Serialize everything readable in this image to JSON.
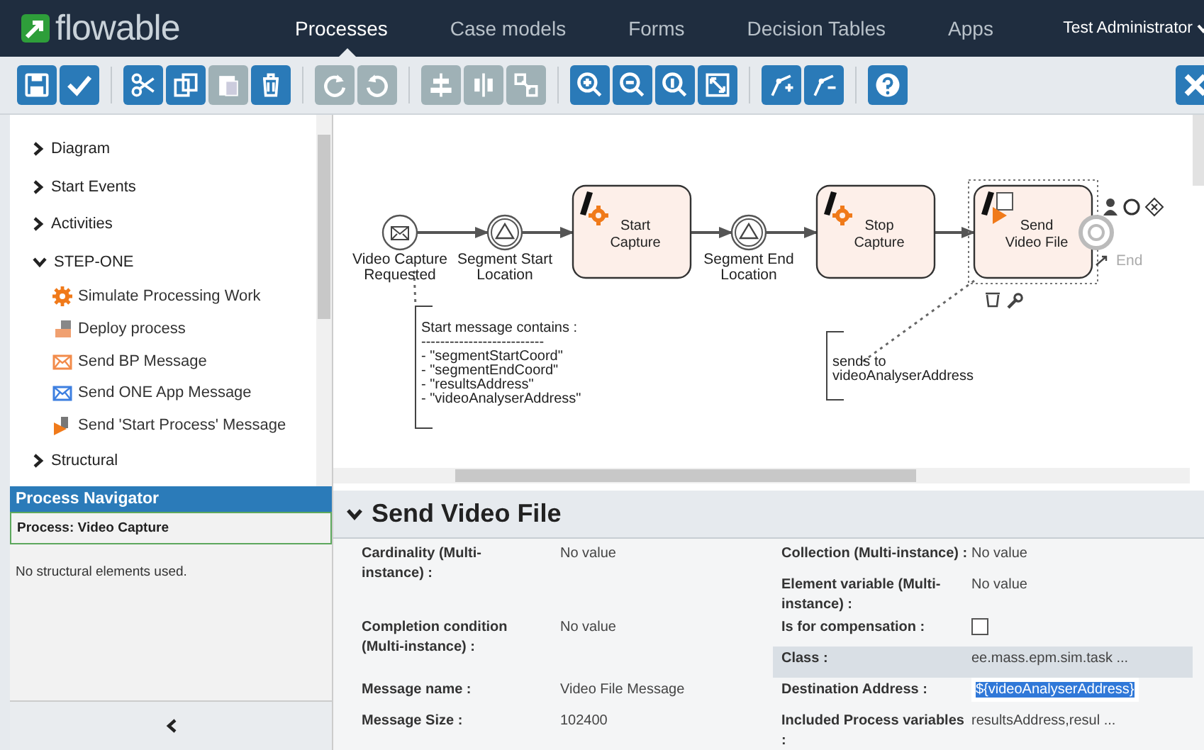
{
  "header": {
    "logo": "flowable",
    "nav": [
      {
        "label": "Processes",
        "selected": true
      },
      {
        "label": "Case models",
        "selected": false
      },
      {
        "label": "Forms",
        "selected": false
      },
      {
        "label": "Decision Tables",
        "selected": false
      },
      {
        "label": "Apps",
        "selected": false
      }
    ],
    "user": "Test Administrator"
  },
  "toolbar": {
    "groups": [
      [
        {
          "kind": "save",
          "disabled": false
        },
        {
          "kind": "check",
          "disabled": false
        }
      ],
      [
        {
          "kind": "cut",
          "disabled": false
        },
        {
          "kind": "copy",
          "disabled": false
        },
        {
          "kind": "paste",
          "disabled": true
        },
        {
          "kind": "delete",
          "disabled": false
        }
      ],
      [
        {
          "kind": "redo",
          "disabled": true
        },
        {
          "kind": "undo",
          "disabled": true
        }
      ],
      [
        {
          "kind": "align",
          "disabled": true
        },
        {
          "kind": "center",
          "disabled": true
        },
        {
          "kind": "same",
          "disabled": true
        }
      ],
      [
        {
          "kind": "zoomin",
          "disabled": false
        },
        {
          "kind": "zoomout",
          "disabled": false
        },
        {
          "kind": "zoomreset",
          "disabled": false
        },
        {
          "kind": "fit",
          "disabled": false
        }
      ],
      [
        {
          "kind": "addbend",
          "disabled": false
        },
        {
          "kind": "removebend",
          "disabled": false
        }
      ],
      [
        {
          "kind": "help",
          "disabled": false
        }
      ]
    ],
    "close": {
      "kind": "close",
      "disabled": false
    }
  },
  "palette": [
    {
      "label": "Diagram",
      "expanded": false
    },
    {
      "label": "Start Events",
      "expanded": false
    },
    {
      "label": "Activities",
      "expanded": false
    },
    {
      "label": "STEP-ONE",
      "expanded": true,
      "children": [
        {
          "label": "Simulate Processing Work",
          "kind": "gear",
          "color": "#f07a1a"
        },
        {
          "label": "Deploy process",
          "kind": "deploy",
          "color": "#f0a070"
        },
        {
          "label": "Send BP Message",
          "kind": "mail",
          "color": "#f28b4a"
        },
        {
          "label": "Send ONE App Message",
          "kind": "mail",
          "color": "#3d7fe0"
        },
        {
          "label": "Send 'Start Process' Message",
          "kind": "file",
          "color": "#f07a1a"
        }
      ]
    },
    {
      "label": "Structural",
      "expanded": false
    }
  ],
  "navigator": {
    "title": "Process Navigator",
    "process": "Process: Video Capture",
    "message": "No structural elements used."
  },
  "diagram": {
    "nodes": [
      {
        "kind": "message",
        "label": "Video Capture Requested",
        "selected": false
      },
      {
        "kind": "signal",
        "label": "Segment Start Location",
        "selected": false
      },
      {
        "kind": "service",
        "label": "Start Capture",
        "selected": false
      },
      {
        "kind": "signal",
        "label": "Segment End Location",
        "selected": false
      },
      {
        "kind": "service",
        "label": "Stop Capture",
        "selected": false
      },
      {
        "kind": "send",
        "label": "Send Video File",
        "selected": true
      },
      {
        "kind": "end",
        "label": "End",
        "selected": false
      }
    ],
    "annotations": [
      {
        "lines": [
          "Start message contains :",
          "--------------------------",
          "- \"segmentStartCoord\"",
          "- \"segmentEndCoord\"",
          "- \"resultsAddress\"",
          "- \"videoAnalyserAddress\""
        ]
      },
      {
        "lines": [
          "sends to",
          "videoAnalyserAddress"
        ]
      }
    ]
  },
  "properties": {
    "title": "Send Video File",
    "left": [
      {
        "label": "Cardinality (Multi-instance) :",
        "kind": "text",
        "value": "No value"
      },
      {
        "label": "Completion condition (Multi-instance) :",
        "kind": "text",
        "value": "No value"
      },
      {
        "label": "Message name :",
        "kind": "text",
        "value": "Video File Message"
      },
      {
        "label": "Message Size :",
        "kind": "text",
        "value": "102400"
      }
    ],
    "right": [
      {
        "label": "Collection (Multi-instance) :",
        "kind": "text",
        "value": "No value",
        "highlighted": false
      },
      {
        "label": "Element variable (Multi-instance) :",
        "kind": "text",
        "value": "No value",
        "highlighted": false
      },
      {
        "label": "Is for compensation :",
        "kind": "checkbox",
        "checked": false,
        "highlighted": false
      },
      {
        "label": "Class :",
        "kind": "text",
        "value": "ee.mass.epm.sim.task ...",
        "highlighted": true
      },
      {
        "label": "Destination Address :",
        "kind": "input",
        "value": "${videoAnalyserAddress}",
        "highlighted": false
      },
      {
        "label": "Included Process variables :",
        "kind": "text",
        "value": "resultsAddress,resul ...",
        "highlighted": false
      }
    ]
  }
}
